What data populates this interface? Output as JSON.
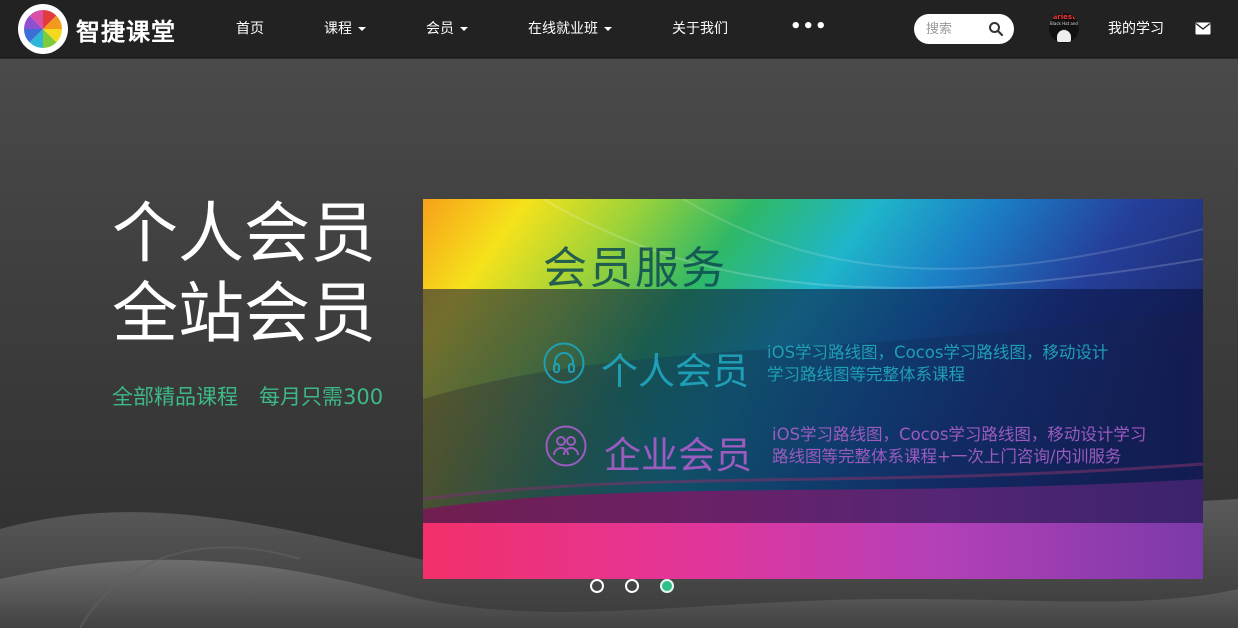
{
  "brand": {
    "name": "智捷课堂"
  },
  "nav": {
    "home": "首页",
    "courses": "课程",
    "membership": "会员",
    "online_class": "在线就业班",
    "about": "关于我们",
    "more": "•••"
  },
  "search": {
    "placeholder": "搜索",
    "value": ""
  },
  "user": {
    "avatar_line1": "ariest",
    "avatar_line2": "Black Hat and ...",
    "my_learning": "我的学习"
  },
  "hero": {
    "title_line1": "个人会员",
    "title_line2": "全站会员",
    "subtitle": "全部精品课程　每月只需300"
  },
  "banner": {
    "heading": "会员服务",
    "tiers": [
      {
        "name": "个人会员",
        "desc_line1": "iOS学习路线图，Cocos学习路线图，移动设计",
        "desc_line2": "学习路线图等完整体系课程",
        "icon": "headphones-icon",
        "color": "#1f9fb5"
      },
      {
        "name": "企业会员",
        "desc_line1": "iOS学习路线图，Cocos学习路线图，移动设计学习",
        "desc_line2": "路线图等完整体系课程+一次上门咨询/内训服务",
        "icon": "group-icon",
        "color": "#9b5bbf"
      }
    ]
  },
  "carousel": {
    "slide_count": 3,
    "active_index": 2
  },
  "colors": {
    "accent_green": "#3db986",
    "navbar": "#222222"
  }
}
